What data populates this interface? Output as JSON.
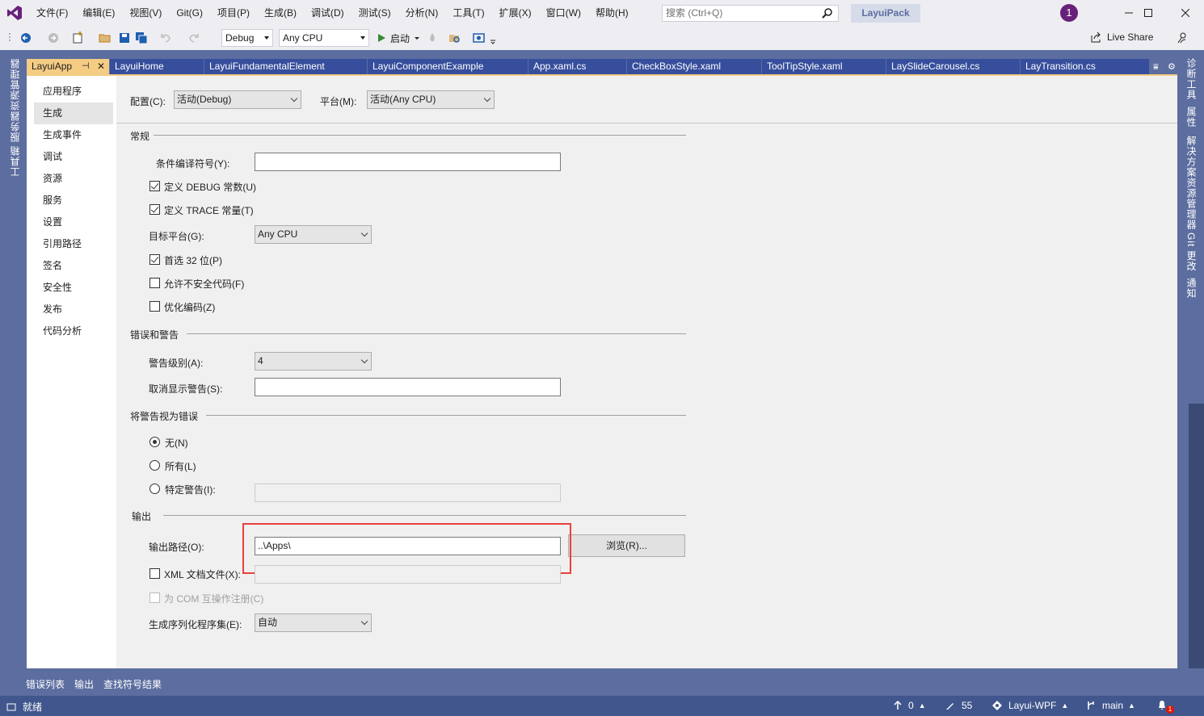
{
  "menubar": {
    "items": [
      "文件(F)",
      "编辑(E)",
      "视图(V)",
      "Git(G)",
      "项目(P)",
      "生成(B)",
      "调试(D)",
      "测试(S)",
      "分析(N)",
      "工具(T)",
      "扩展(X)",
      "窗口(W)",
      "帮助(H)"
    ],
    "search_placeholder": "搜索 (Ctrl+Q)",
    "solution_name": "LayuiPack",
    "notification_count": "1"
  },
  "toolbar": {
    "config": "Debug",
    "platform": "Any CPU",
    "start": "启动",
    "live_share": "Live Share"
  },
  "rails": {
    "left": [
      "服务器资源管理器",
      "工具箱"
    ],
    "right": [
      "诊断工具",
      "属性",
      "解决方案资源管理器",
      "Git 更改",
      "通知"
    ]
  },
  "tabs": [
    {
      "label": "LayuiApp",
      "active": true
    },
    {
      "label": "LayuiHome"
    },
    {
      "label": "LayuiFundamentalElement"
    },
    {
      "label": "LayuiComponentExample"
    },
    {
      "label": "App.xaml.cs"
    },
    {
      "label": "CheckBoxStyle.xaml"
    },
    {
      "label": "ToolTipStyle.xaml"
    },
    {
      "label": "LaySlideCarousel.cs"
    },
    {
      "label": "LayTransition.cs"
    }
  ],
  "nav": {
    "items": [
      "应用程序",
      "生成",
      "生成事件",
      "调试",
      "资源",
      "服务",
      "设置",
      "引用路径",
      "签名",
      "安全性",
      "发布",
      "代码分析"
    ],
    "active": "生成"
  },
  "build": {
    "config_label": "配置(C):",
    "config_value": "活动(Debug)",
    "platform_label": "平台(M):",
    "platform_value": "活动(Any CPU)",
    "general": {
      "title": "常规",
      "conditional_label": "条件编译符号(Y):",
      "conditional_value": "",
      "define_debug": "定义 DEBUG 常数(U)",
      "define_trace": "定义 TRACE 常量(T)",
      "target_label": "目标平台(G):",
      "target_value": "Any CPU",
      "prefer32": "首选 32 位(P)",
      "unsafe": "允许不安全代码(F)",
      "optimize": "优化编码(Z)"
    },
    "errors": {
      "title": "错误和警告",
      "warning_level_label": "警告级别(A):",
      "warning_level_value": "4",
      "suppress_label": "取消显示警告(S):",
      "suppress_value": ""
    },
    "treat": {
      "title": "将警告视为错误",
      "none": "无(N)",
      "all": "所有(L)",
      "specific": "特定警告(I):"
    },
    "output": {
      "title": "输出",
      "path_label": "输出路径(O):",
      "path_value": "..\\Apps\\",
      "browse": "浏览(R)...",
      "xml_doc": "XML 文档文件(X):",
      "com_register": "为 COM 互操作注册(C)",
      "serialization_label": "生成序列化程序集(E):",
      "serialization_value": "自动"
    }
  },
  "bottom_tabs": [
    "错误列表",
    "输出",
    "查找符号结果"
  ],
  "status": {
    "ready": "就绪",
    "up_count": "0",
    "pencil_count": "55",
    "repo": "Layui-WPF",
    "branch": "main",
    "bell_count": "1"
  },
  "colors": {
    "accent_tab": "#f5cc84",
    "chrome": "#5c6d9f",
    "status": "#40568d",
    "highlight": "#e8403a",
    "vs_purple": "#68217a"
  }
}
